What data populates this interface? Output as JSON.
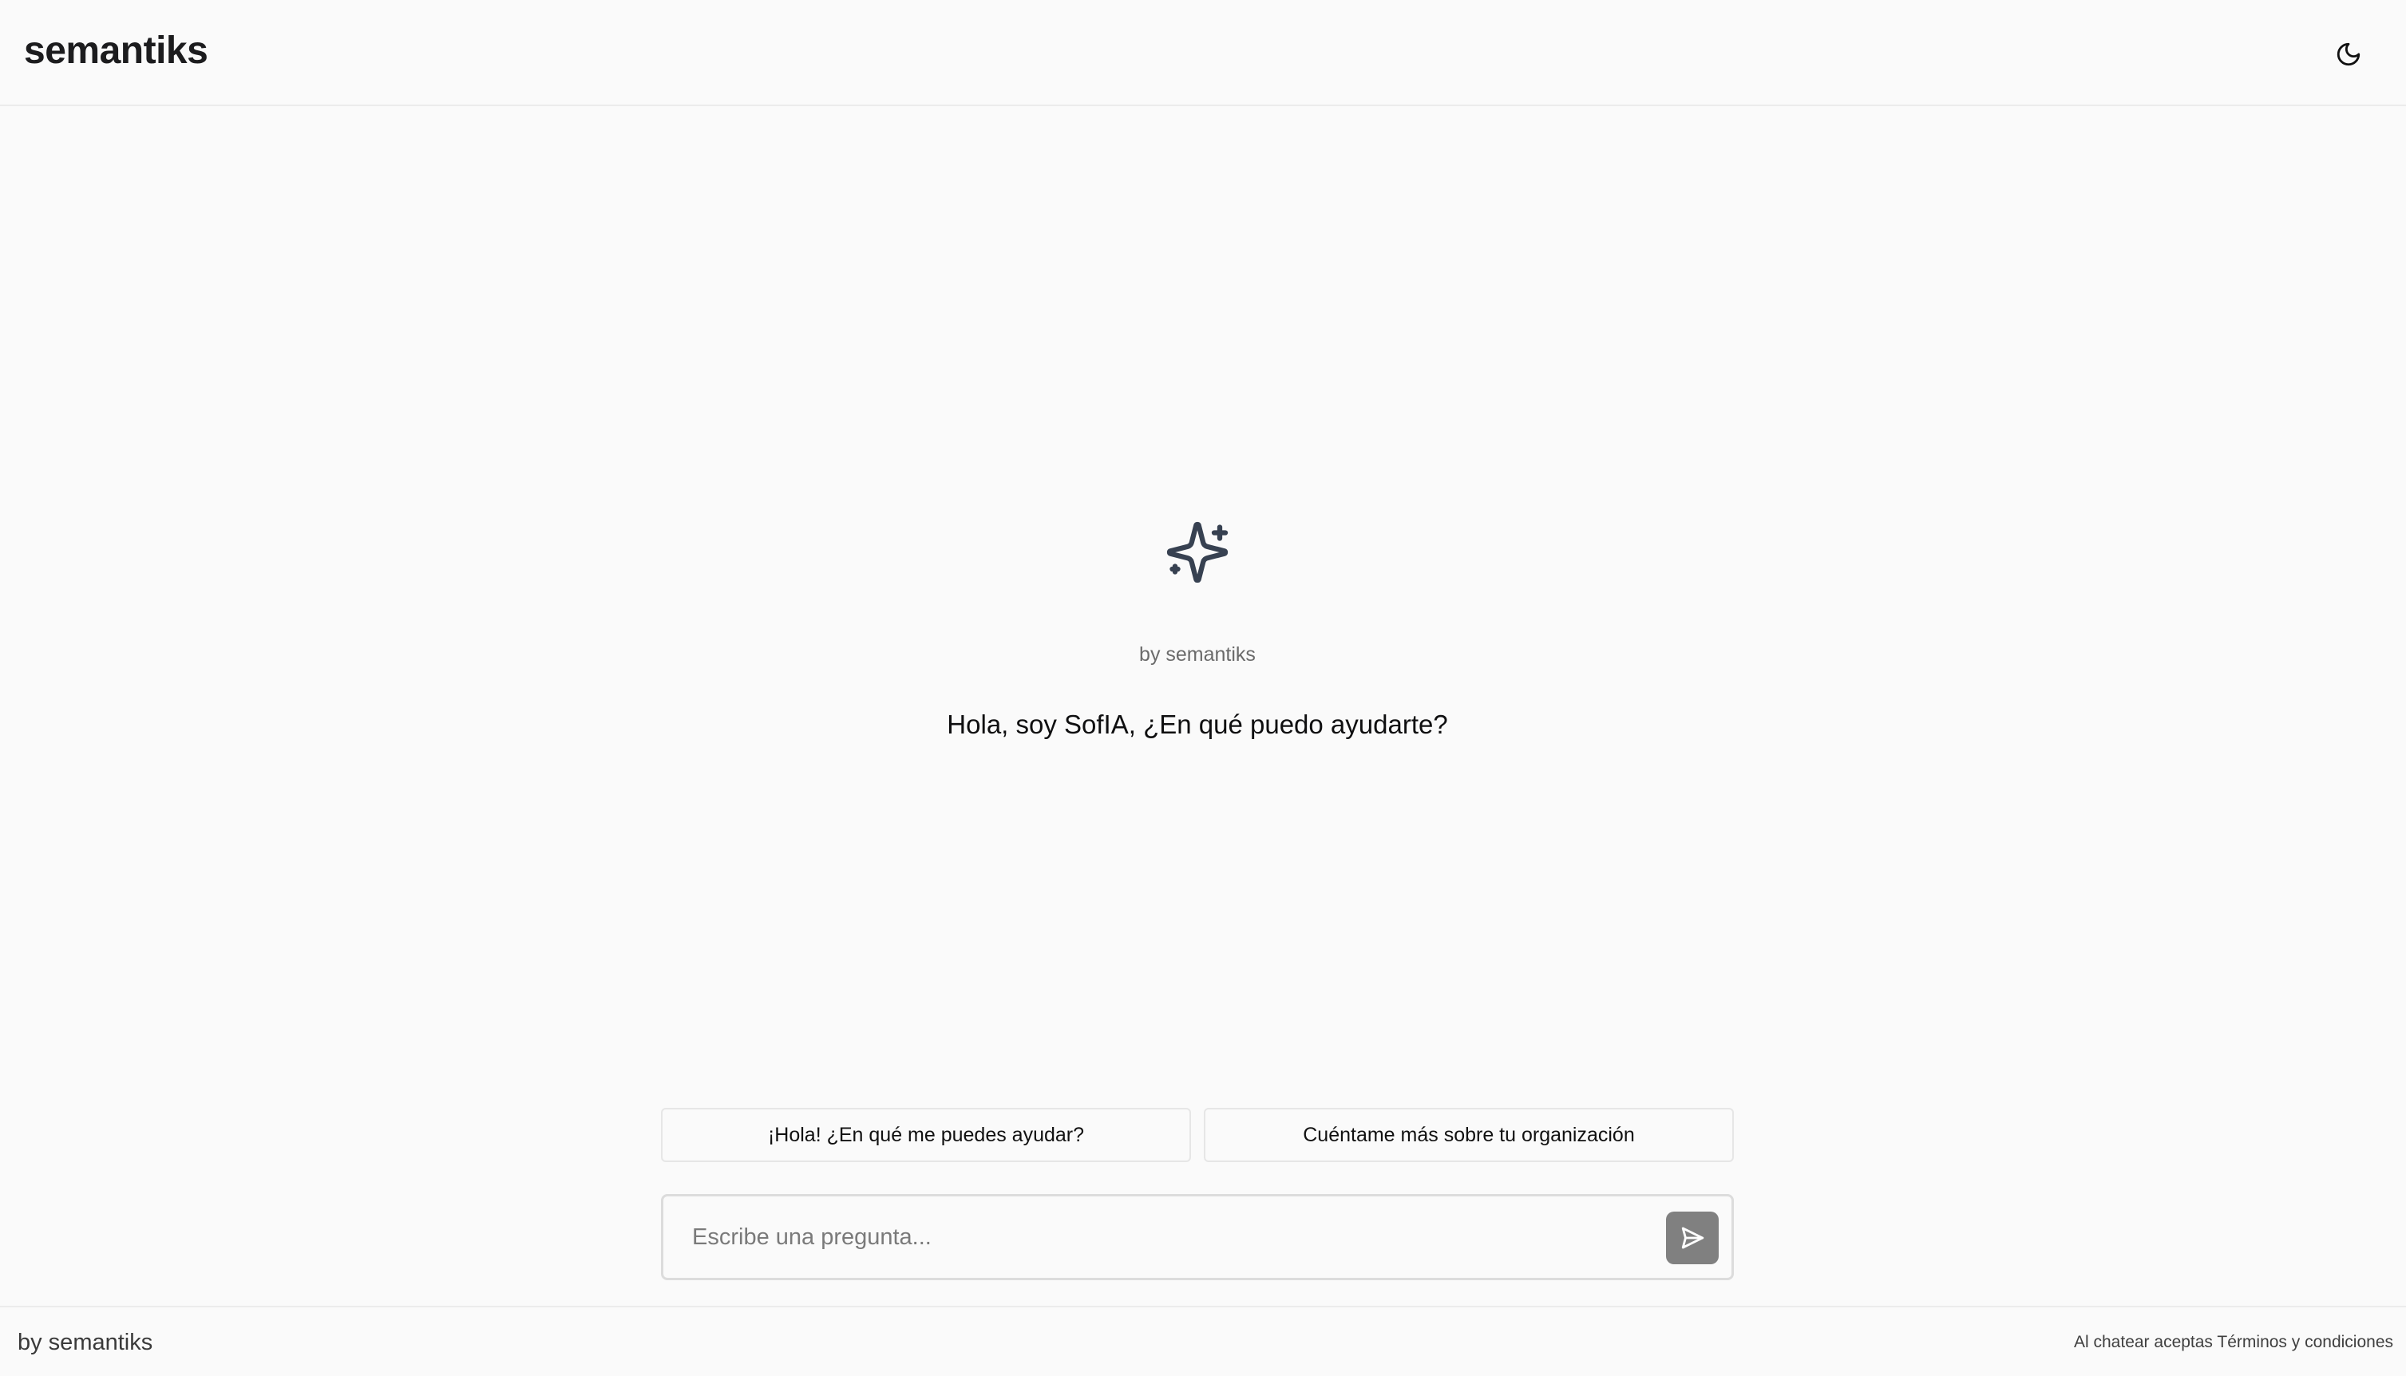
{
  "header": {
    "brand": "semantiks",
    "theme_toggle_icon": "moon-icon"
  },
  "hero": {
    "icon": "sparkles-icon",
    "by_label": "by semantiks",
    "greeting": "Hola, soy SofIA, ¿En qué puedo ayudarte?"
  },
  "suggestions": [
    {
      "label": "¡Hola! ¿En qué me puedes ayudar?"
    },
    {
      "label": "Cuéntame más sobre tu organización"
    }
  ],
  "composer": {
    "placeholder": "Escribe una pregunta...",
    "value": "",
    "send_icon": "send-icon"
  },
  "footer": {
    "brand": "by semantiks",
    "legal_prefix": "Al chatear aceptas",
    "legal_link": "Términos y condiciones"
  },
  "colors": {
    "background": "#fafafa",
    "send_button": "#808080",
    "icon": "#374151"
  }
}
